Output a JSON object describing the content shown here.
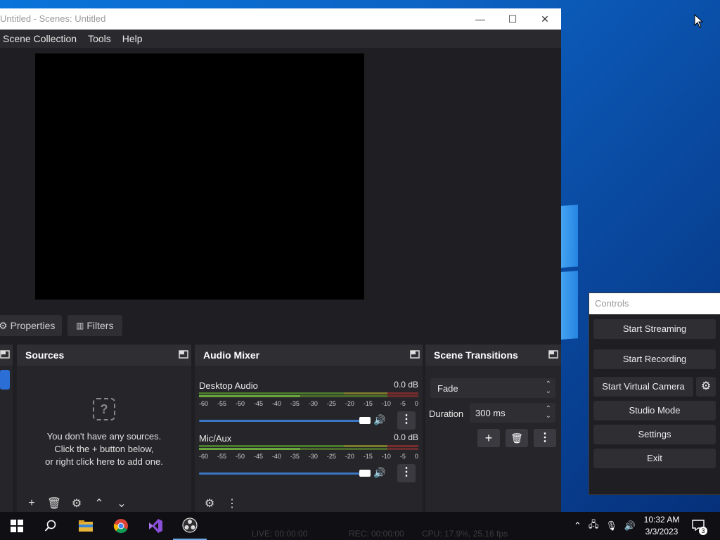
{
  "window": {
    "title": "Untitled - Scenes: Untitled",
    "minimize": "—",
    "maximize": "☐",
    "close": "✕"
  },
  "menu": [
    "Scene Collection",
    "Tools",
    "Help"
  ],
  "prop_bar": {
    "properties": "Properties",
    "filters": "Filters"
  },
  "sources": {
    "title": "Sources",
    "empty_line1": "You don't have any sources.",
    "empty_line2": "Click the + button below,",
    "empty_line3": "or right click here to add one."
  },
  "mixer": {
    "title": "Audio Mixer",
    "channels": [
      {
        "name": "Desktop Audio",
        "db": "0.0 dB"
      },
      {
        "name": "Mic/Aux",
        "db": "0.0 dB"
      }
    ],
    "ticks": [
      "-60",
      "-55",
      "-50",
      "-45",
      "-40",
      "-35",
      "-30",
      "-25",
      "-20",
      "-15",
      "-10",
      "-5",
      "0"
    ]
  },
  "transitions": {
    "title": "Scene Transitions",
    "selected": "Fade",
    "duration_label": "Duration",
    "duration_value": "300 ms"
  },
  "controls": {
    "title": "Controls",
    "buttons": [
      "Start Streaming",
      "Start Recording",
      "Start Virtual Camera",
      "Studio Mode",
      "Settings",
      "Exit"
    ]
  },
  "taskbar": {
    "time": "10:32 AM",
    "date": "3/3/2023",
    "notifications": "3"
  },
  "status_ghost": {
    "live": "LIVE: 00:00:00",
    "rec": "REC: 00:00:00",
    "cpu": "CPU: 17.9%, 25.16 fps"
  },
  "colors": {
    "accent": "#3a76c4",
    "meter_green": "#4f8a2e",
    "meter_yellow": "#8f8f2e",
    "meter_red": "#8a2e2e",
    "panel": "#26262a"
  }
}
